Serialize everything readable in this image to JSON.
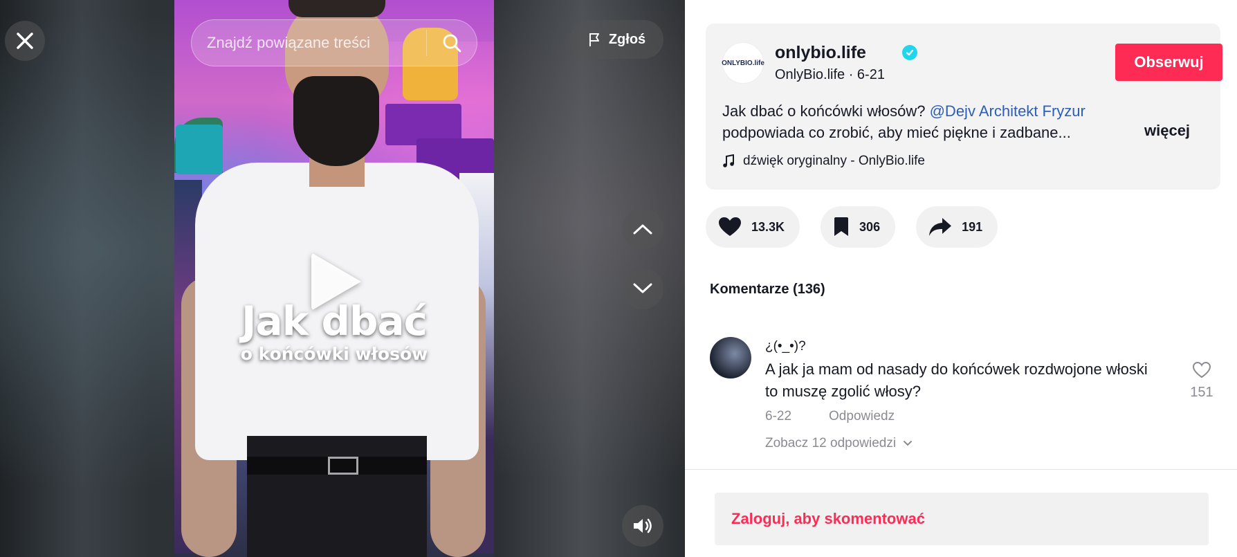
{
  "video": {
    "title_line1": "Jak dbać",
    "title_line2": "o końcówki włosów",
    "search_placeholder": "Znajdź powiązane treści",
    "report_label": "Zgłoś"
  },
  "author": {
    "avatar_text": "ONLYBIO.life",
    "username": "onlybio.life",
    "verified": true,
    "display_line": "OnlyBio.life · 6-21",
    "follow_label": "Obserwuj"
  },
  "description": {
    "text_before_mention": "Jak dbać o końcówki włosów? ",
    "mention": "@Dejv Architekt Fryzur",
    "text_line2": "podpowiada co zrobić, aby mieć piękne i zadbane...",
    "more_label": "więcej",
    "sound": "dźwięk oryginalny - OnlyBio.life"
  },
  "stats": {
    "likes": "13.3K",
    "saves": "306",
    "shares": "191"
  },
  "comments": {
    "title": "Komentarze (136)",
    "items": [
      {
        "user": "¿(•_•)?",
        "text": "A jak ja mam od nasady do końcówek rozdwojone włoski to muszę zgolić włosy?",
        "date": "6-22",
        "reply_label": "Odpowiedz",
        "likes": "151",
        "see_replies": "Zobacz 12 odpowiedzi"
      }
    ]
  },
  "login_prompt": "Zaloguj, aby skomentować",
  "colors": {
    "accent": "#fe2c55",
    "mention": "#2b5db9",
    "verified": "#20d5ec"
  }
}
